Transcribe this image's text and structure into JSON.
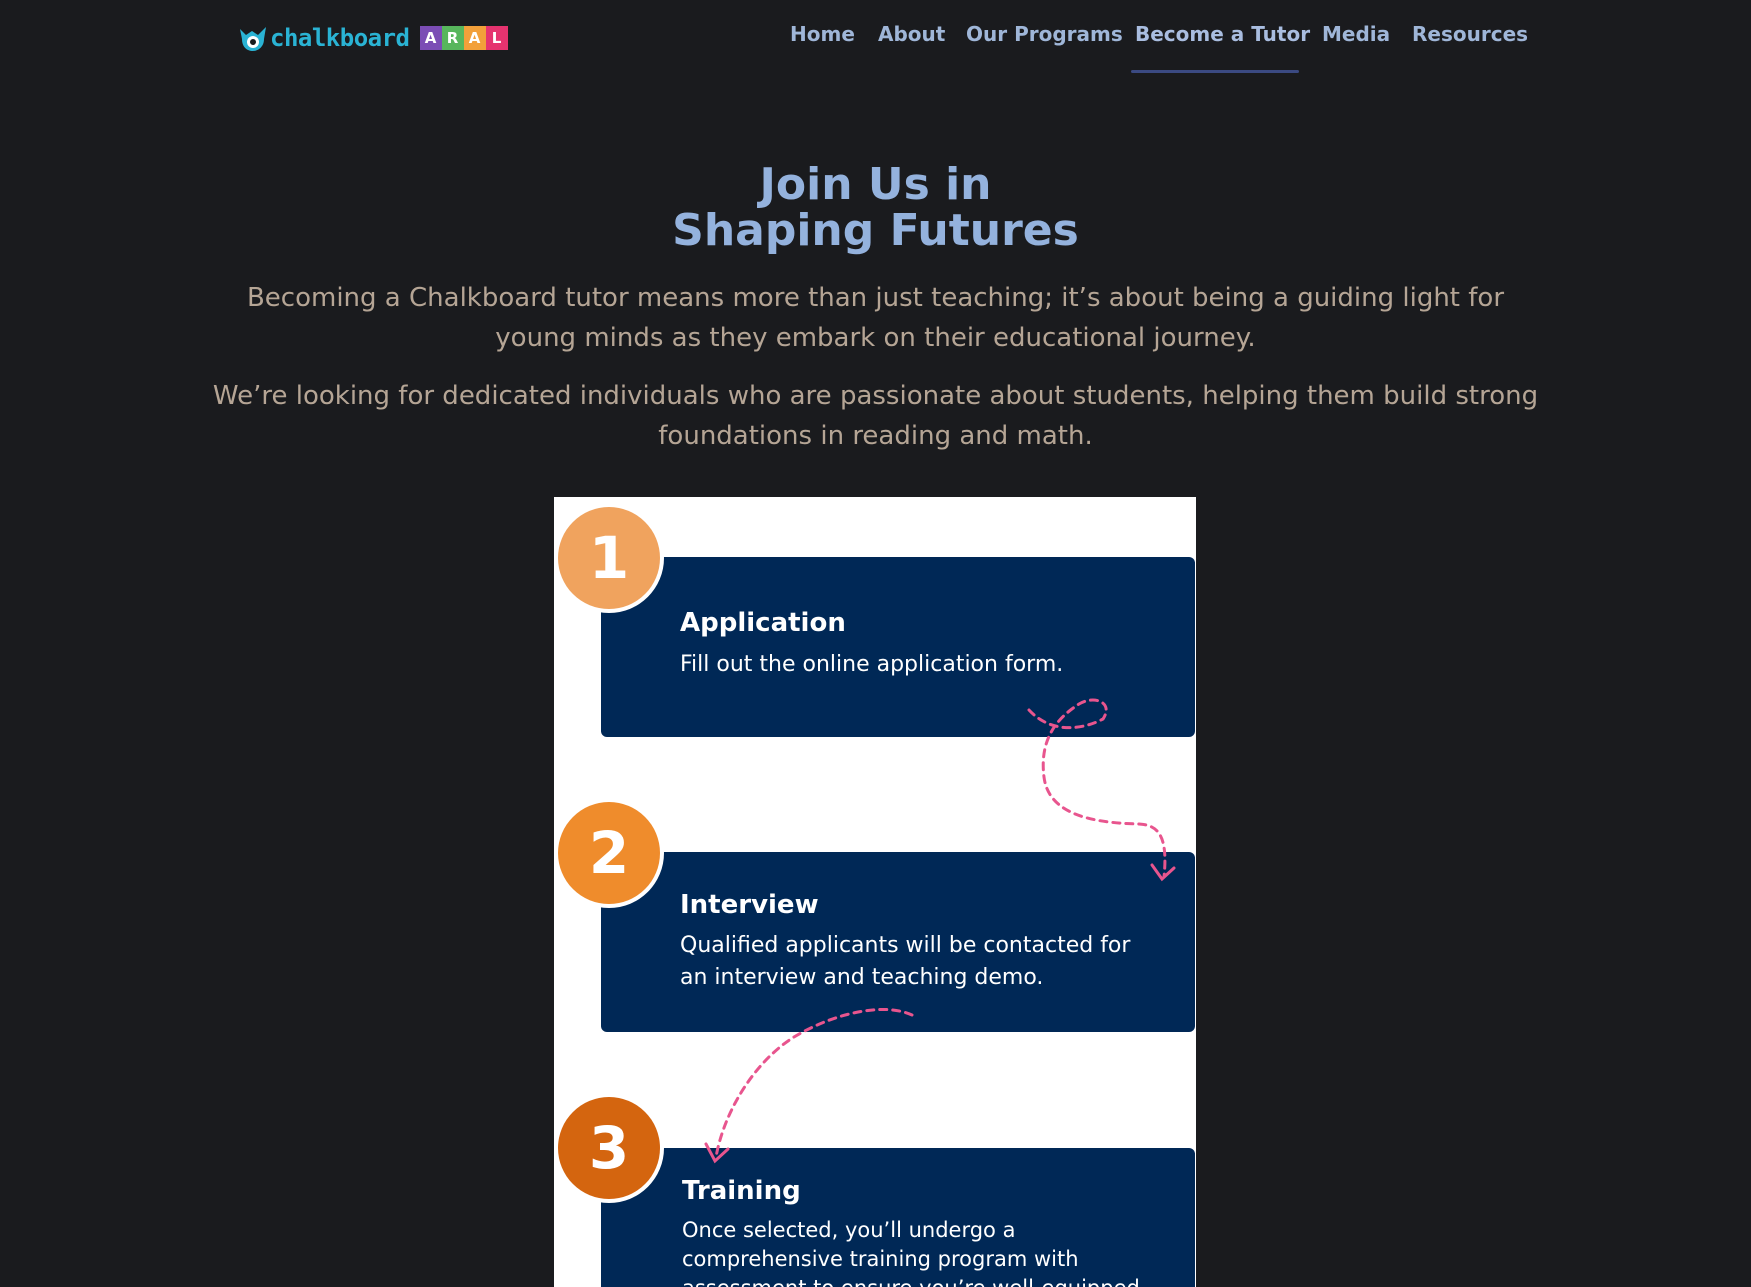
{
  "brand": {
    "wordmark": "chalkboard",
    "tiles": [
      "A",
      "R",
      "A",
      "L"
    ],
    "tile_colors": [
      "#7b4db5",
      "#57b65c",
      "#f2a03a",
      "#e5336f"
    ]
  },
  "nav": {
    "items": [
      {
        "label": "Home"
      },
      {
        "label": "About"
      },
      {
        "label": "Our Programs"
      },
      {
        "label": "Become a Tutor"
      },
      {
        "label": "Media"
      },
      {
        "label": "Resources"
      }
    ],
    "active": "Become a Tutor"
  },
  "hero": {
    "title_line1": "Join Us in",
    "title_line2": "Shaping Futures",
    "paragraph1": "Becoming a Chalkboard tutor means more than just teaching; it’s about being a guiding light for young minds as they embark on their educational journey.",
    "paragraph2": "We’re looking for dedicated individuals who are passionate about students, helping them build strong foundations in reading and math."
  },
  "steps": [
    {
      "number": "1",
      "title": "Application",
      "description": "Fill out the online application form.",
      "badge_color": "#f0a35e"
    },
    {
      "number": "2",
      "title": "Interview",
      "description": "Qualified applicants will be contacted for an interview and teaching demo.",
      "badge_color": "#ef8c2c"
    },
    {
      "number": "3",
      "title": "Training",
      "description": "Once selected, you’ll undergo a comprehensive training program with assessment to ensure you’re well-equipped to support your students.",
      "badge_color": "#d4650f"
    }
  ],
  "colors": {
    "background": "#1a1b1e",
    "nav_text": "#9fb6d8",
    "title": "#94b2dd",
    "body_text": "#b5a595",
    "card": "#002856",
    "arrow": "#e8558e"
  }
}
